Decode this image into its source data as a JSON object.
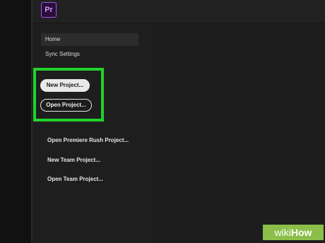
{
  "app": {
    "logo_text": "Pr",
    "accent_color": "#9b5de5"
  },
  "sidebar": {
    "items": [
      {
        "label": "Home",
        "active": true
      },
      {
        "label": "Sync Settings",
        "active": false
      }
    ]
  },
  "actions": {
    "new_project": "New Project...",
    "open_project": "Open Project...",
    "highlight_color": "#22d32a"
  },
  "links": [
    {
      "label": "Open Premiere Rush Project..."
    },
    {
      "label": "New Team Project..."
    },
    {
      "label": "Open Team Project..."
    }
  ],
  "watermark": {
    "part1": "wiki",
    "part2": "How"
  }
}
